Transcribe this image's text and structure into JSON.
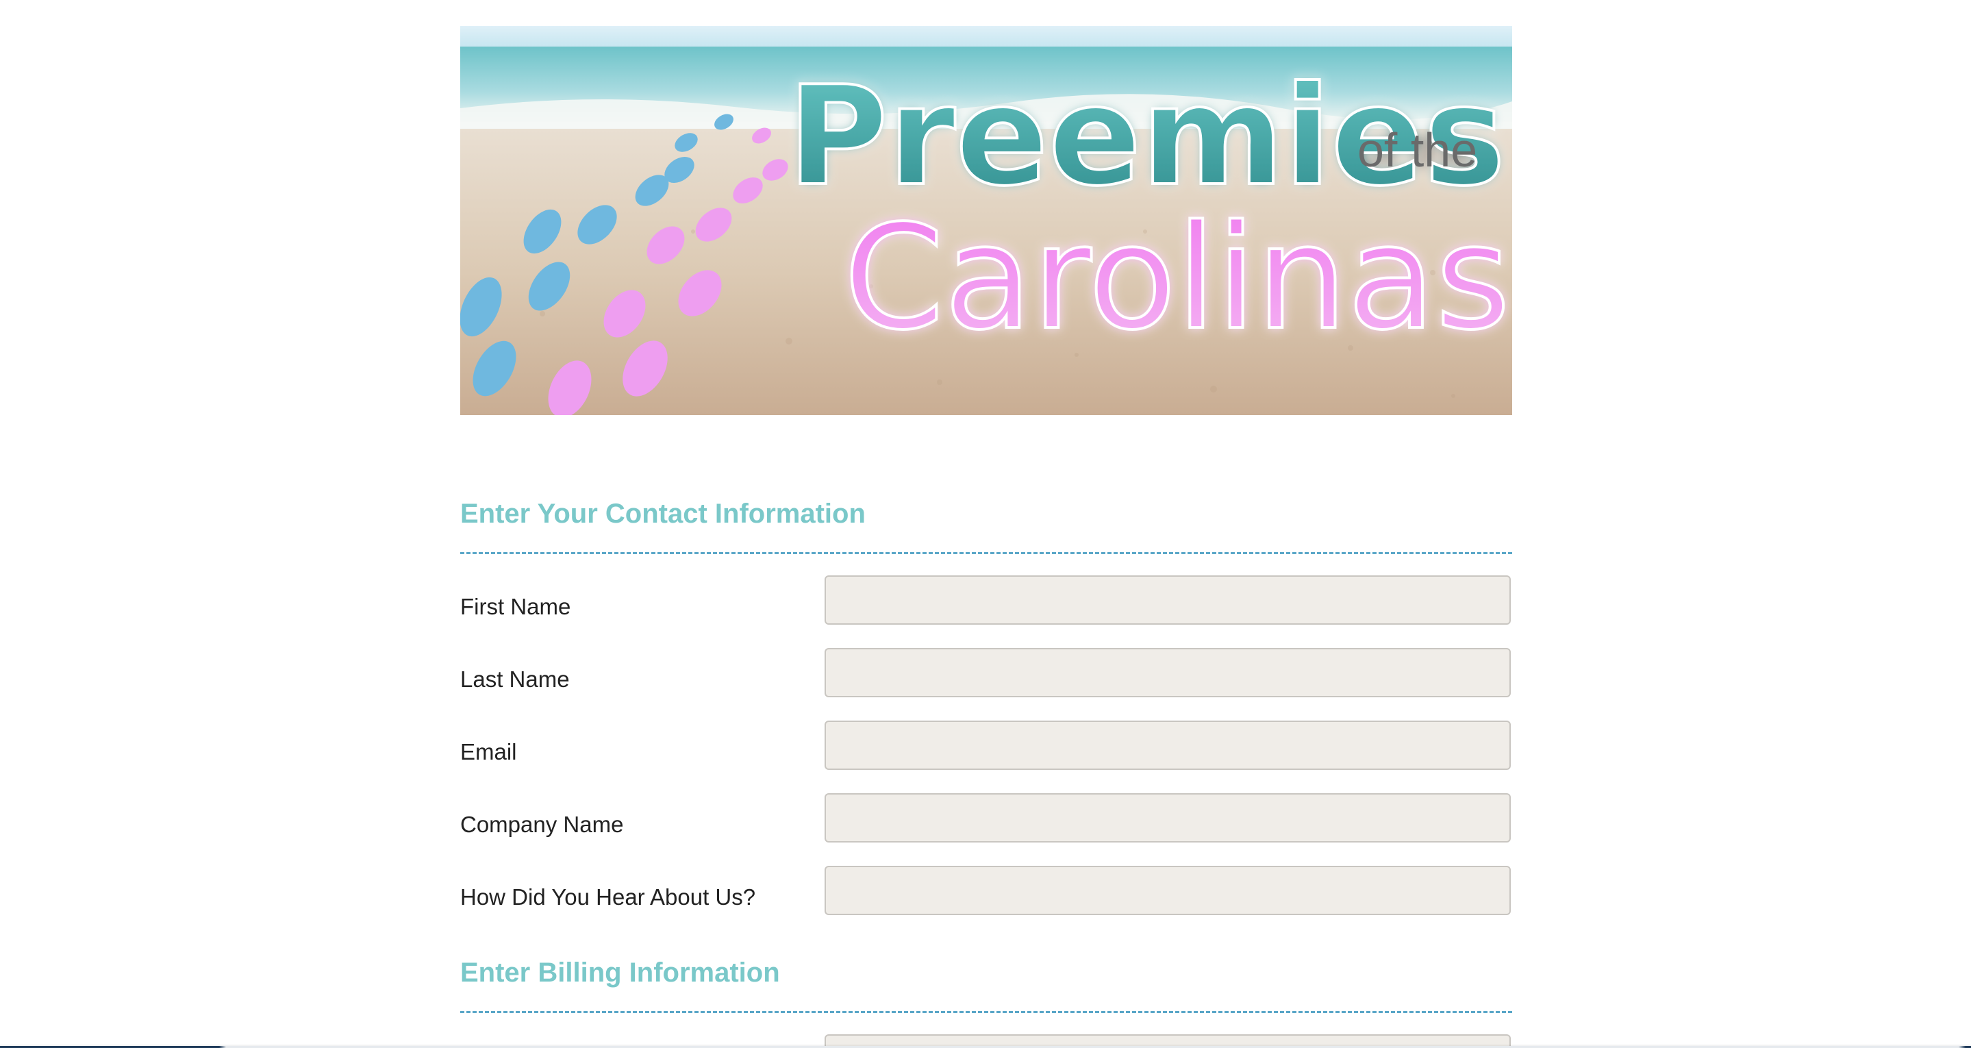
{
  "banner": {
    "logo_line1": "Preemies",
    "logo_line1_small": "of the",
    "logo_line2": "Carolinas",
    "colors": {
      "teal": "#3fa7a6",
      "pink": "#ee8ef0",
      "blue_footprint": "#6fb8df",
      "gray_text": "#6b6b6b"
    }
  },
  "contact_section": {
    "heading": "Enter Your Contact Information",
    "fields": [
      {
        "label": "First Name",
        "value": "",
        "placeholder": ""
      },
      {
        "label": "Last Name",
        "value": "",
        "placeholder": ""
      },
      {
        "label": "Email",
        "value": "",
        "placeholder": ""
      },
      {
        "label": "Company Name",
        "value": "",
        "placeholder": ""
      },
      {
        "label": "How Did You Hear About Us?",
        "value": "",
        "placeholder": ""
      }
    ]
  },
  "billing_section": {
    "heading": "Enter Billing Information"
  },
  "colors": {
    "heading": "#7ac8c9",
    "divider": "#5aa7c8",
    "input_bg": "#f0ede8",
    "input_border": "#c9c6c1",
    "label_text": "#222222"
  }
}
